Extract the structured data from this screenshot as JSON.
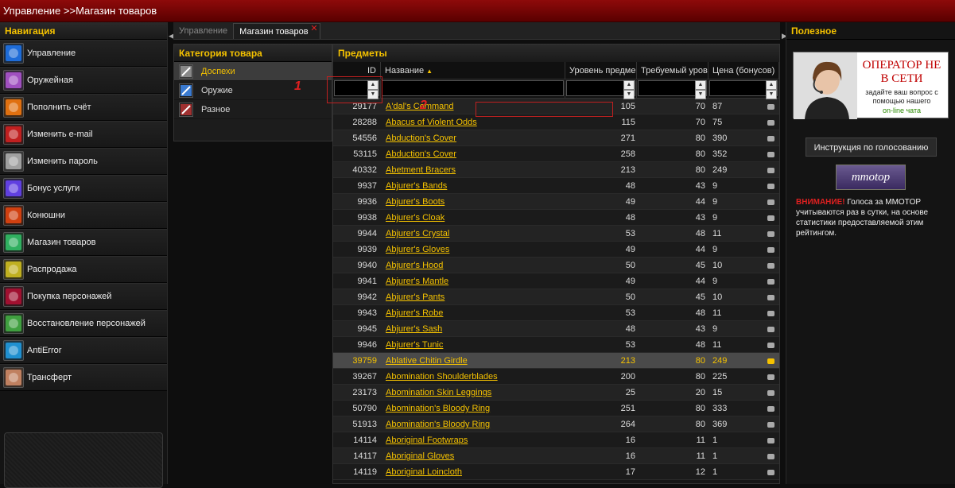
{
  "titlebar": {
    "title": "Управление >>Магазин товаров"
  },
  "navigation": {
    "title": "Навигация",
    "items": [
      {
        "label": "Управление",
        "icon": "management-icon",
        "color": "#1e6cd8"
      },
      {
        "label": "Оружейная",
        "icon": "armory-icon",
        "color": "#a050c0"
      },
      {
        "label": "Пополнить счёт",
        "icon": "deposit-icon",
        "color": "#e07010"
      },
      {
        "label": "Изменить e-mail",
        "icon": "email-icon",
        "color": "#c02020"
      },
      {
        "label": "Изменить пароль",
        "icon": "password-icon",
        "color": "#a0a0a0"
      },
      {
        "label": "Бонус услуги",
        "icon": "bonus-icon",
        "color": "#6040e0"
      },
      {
        "label": "Конюшни",
        "icon": "stables-icon",
        "color": "#d04010"
      },
      {
        "label": "Магазин товаров",
        "icon": "shop-icon",
        "color": "#30b060"
      },
      {
        "label": "Распродажа",
        "icon": "sale-icon",
        "color": "#c0b020"
      },
      {
        "label": "Покупка персонажей",
        "icon": "buy-character-icon",
        "color": "#a01030"
      },
      {
        "label": "Восстановление персонажей",
        "icon": "restore-character-icon",
        "color": "#40a040"
      },
      {
        "label": "AntiError",
        "icon": "antierror-icon",
        "color": "#2090d0"
      },
      {
        "label": "Трансферт",
        "icon": "transfer-icon",
        "color": "#c08060"
      }
    ]
  },
  "tabs": [
    {
      "label": "Управление",
      "active": false
    },
    {
      "label": "Магазин товаров",
      "active": true,
      "close": "✕"
    }
  ],
  "categories": {
    "title": "Категория товара",
    "items": [
      {
        "label": "Доспехи",
        "icon": "armor-icon",
        "selected": true
      },
      {
        "label": "Оружие",
        "icon": "weapon-icon",
        "selected": false
      },
      {
        "label": "Разное",
        "icon": "misc-icon",
        "selected": false
      }
    ]
  },
  "items": {
    "title": "Предметы",
    "columns": {
      "id": "ID",
      "name": "Название",
      "level": "Уровень предме",
      "required": "Требуемый уров",
      "price": "Цена (бонусов)"
    },
    "rows": [
      {
        "id": "29177",
        "name": "A'dal's Command",
        "level": "105",
        "req": "70",
        "price": "87"
      },
      {
        "id": "28288",
        "name": "Abacus of Violent Odds",
        "level": "115",
        "req": "70",
        "price": "75"
      },
      {
        "id": "54556",
        "name": "Abduction's Cover",
        "level": "271",
        "req": "80",
        "price": "390"
      },
      {
        "id": "53115",
        "name": "Abduction's Cover",
        "level": "258",
        "req": "80",
        "price": "352"
      },
      {
        "id": "40332",
        "name": "Abetment Bracers",
        "level": "213",
        "req": "80",
        "price": "249"
      },
      {
        "id": "9937",
        "name": "Abjurer's Bands",
        "level": "48",
        "req": "43",
        "price": "9"
      },
      {
        "id": "9936",
        "name": "Abjurer's Boots",
        "level": "49",
        "req": "44",
        "price": "9"
      },
      {
        "id": "9938",
        "name": "Abjurer's Cloak",
        "level": "48",
        "req": "43",
        "price": "9"
      },
      {
        "id": "9944",
        "name": "Abjurer's Crystal",
        "level": "53",
        "req": "48",
        "price": "11"
      },
      {
        "id": "9939",
        "name": "Abjurer's Gloves",
        "level": "49",
        "req": "44",
        "price": "9"
      },
      {
        "id": "9940",
        "name": "Abjurer's Hood",
        "level": "50",
        "req": "45",
        "price": "10"
      },
      {
        "id": "9941",
        "name": "Abjurer's Mantle",
        "level": "49",
        "req": "44",
        "price": "9"
      },
      {
        "id": "9942",
        "name": "Abjurer's Pants",
        "level": "50",
        "req": "45",
        "price": "10"
      },
      {
        "id": "9943",
        "name": "Abjurer's Robe",
        "level": "53",
        "req": "48",
        "price": "11"
      },
      {
        "id": "9945",
        "name": "Abjurer's Sash",
        "level": "48",
        "req": "43",
        "price": "9"
      },
      {
        "id": "9946",
        "name": "Abjurer's Tunic",
        "level": "53",
        "req": "48",
        "price": "11"
      },
      {
        "id": "39759",
        "name": "Ablative Chitin Girdle",
        "level": "213",
        "req": "80",
        "price": "249",
        "highlight": true
      },
      {
        "id": "39267",
        "name": "Abomination Shoulderblades",
        "level": "200",
        "req": "80",
        "price": "225"
      },
      {
        "id": "23173",
        "name": "Abomination Skin Leggings",
        "level": "25",
        "req": "20",
        "price": "15"
      },
      {
        "id": "50790",
        "name": "Abomination's Bloody Ring",
        "level": "251",
        "req": "80",
        "price": "333"
      },
      {
        "id": "51913",
        "name": "Abomination's Bloody Ring",
        "level": "264",
        "req": "80",
        "price": "369"
      },
      {
        "id": "14114",
        "name": "Aboriginal Footwraps",
        "level": "16",
        "req": "11",
        "price": "1"
      },
      {
        "id": "14117",
        "name": "Aboriginal Gloves",
        "level": "16",
        "req": "11",
        "price": "1"
      },
      {
        "id": "14119",
        "name": "Aboriginal Loincloth",
        "level": "17",
        "req": "12",
        "price": "1"
      }
    ]
  },
  "annotations": {
    "one": "1",
    "two": "2"
  },
  "useful": {
    "title": "Полезное",
    "operator_title": "ОПЕРАТОР НЕ В СЕТИ",
    "operator_sub": "задайте ваш вопрос с помощью нашего",
    "operator_chat": "on-line чата",
    "vote_button": "Инструкция по голосованию",
    "mmotop": "mmotop",
    "warning_label": "ВНИМАНИЕ!",
    "warning_text": " Голоса за MMOTOP учитываются раз в сутки, на основе статистики предоставляемой этим рейтингом."
  },
  "colors": {
    "accent": "#f5c200",
    "titlebar": "#8e0a0a",
    "alert": "#e02020"
  }
}
